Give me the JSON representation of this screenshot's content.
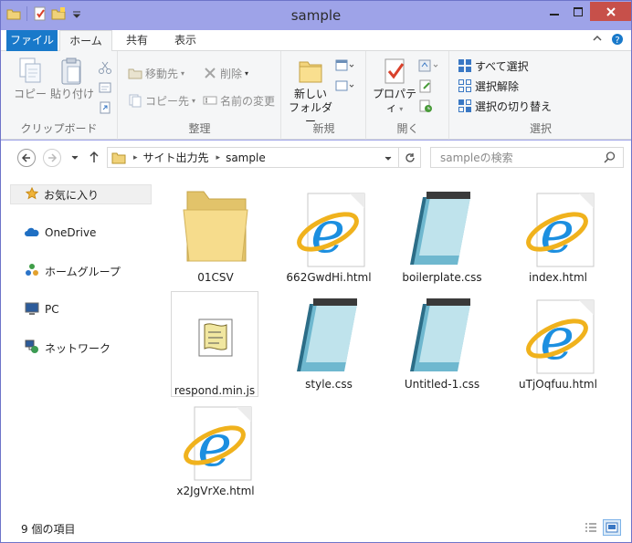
{
  "window": {
    "title": "sample"
  },
  "ribbon_tabs": [
    {
      "label": "ファイル"
    },
    {
      "label": "ホーム"
    },
    {
      "label": "共有"
    },
    {
      "label": "表示"
    }
  ],
  "ribbon": {
    "clipboard": {
      "copy": "コピー",
      "paste": "貼り付け",
      "label": "クリップボード"
    },
    "organize": {
      "move_to": "移動先",
      "copy_to": "コピー先",
      "delete": "削除",
      "rename": "名前の変更",
      "label": "整理"
    },
    "new": {
      "new_folder_line1": "新しい",
      "new_folder_line2": "フォルダー",
      "label": "新規"
    },
    "open": {
      "properties": "プロパティ",
      "label": "開く"
    },
    "select": {
      "select_all": "すべて選択",
      "select_none": "選択解除",
      "invert": "選択の切り替え",
      "label": "選択"
    }
  },
  "address": {
    "crumbs": [
      "サイト出力先",
      "sample"
    ],
    "search_placeholder": "sampleの検索"
  },
  "nav": {
    "favorites": "お気に入り",
    "items": [
      {
        "label": "OneDrive",
        "icon": "cloud-icon"
      },
      {
        "label": "ホームグループ",
        "icon": "homegroup-icon"
      },
      {
        "label": "PC",
        "icon": "pc-icon"
      },
      {
        "label": "ネットワーク",
        "icon": "network-icon"
      }
    ]
  },
  "files": [
    {
      "name": "01CSV",
      "type": "folder"
    },
    {
      "name": "662GwdHi.html",
      "type": "ie"
    },
    {
      "name": "boilerplate.css",
      "type": "notepad"
    },
    {
      "name": "index.html",
      "type": "ie"
    },
    {
      "name": "respond.min.js",
      "type": "script"
    },
    {
      "name": "style.css",
      "type": "notepad"
    },
    {
      "name": "Untitled-1.css",
      "type": "notepad"
    },
    {
      "name": "uTjOqfuu.html",
      "type": "ie"
    },
    {
      "name": "x2JgVrXe.html",
      "type": "ie"
    }
  ],
  "status": {
    "count": "9 個の項目"
  }
}
